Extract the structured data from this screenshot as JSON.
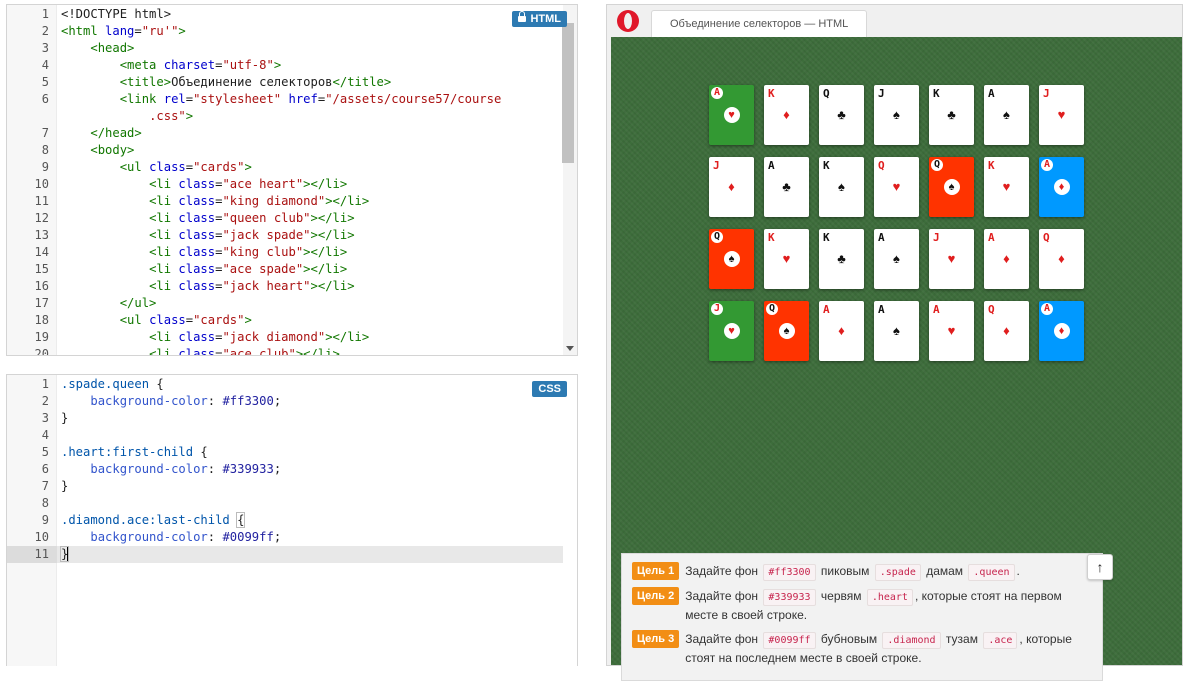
{
  "html_editor": {
    "badge": "HTML",
    "lines": [
      {
        "n": "1",
        "tokens": [
          [
            "t-txt",
            "<!DOCTYPE html>"
          ]
        ]
      },
      {
        "n": "2",
        "tokens": [
          [
            "t-tag",
            "<html "
          ],
          [
            "t-attr",
            "lang"
          ],
          [
            "t-txt",
            "="
          ],
          [
            "t-str",
            "\"ru'\""
          ],
          [
            "t-tag",
            ">"
          ]
        ]
      },
      {
        "n": "3",
        "tokens": [
          [
            "t-txt",
            "    "
          ],
          [
            "t-tag",
            "<head>"
          ]
        ]
      },
      {
        "n": "4",
        "tokens": [
          [
            "t-txt",
            "        "
          ],
          [
            "t-tag",
            "<meta "
          ],
          [
            "t-attr",
            "charset"
          ],
          [
            "t-txt",
            "="
          ],
          [
            "t-str",
            "\"utf-8\""
          ],
          [
            "t-tag",
            ">"
          ]
        ]
      },
      {
        "n": "5",
        "tokens": [
          [
            "t-txt",
            "        "
          ],
          [
            "t-tag",
            "<title>"
          ],
          [
            "t-txt",
            "Объединение селекторов"
          ],
          [
            "t-tag",
            "</title>"
          ]
        ]
      },
      {
        "n": "6",
        "tokens": [
          [
            "t-txt",
            "        "
          ],
          [
            "t-tag",
            "<link "
          ],
          [
            "t-attr",
            "rel"
          ],
          [
            "t-txt",
            "="
          ],
          [
            "t-str",
            "\"stylesheet\""
          ],
          [
            "t-txt",
            " "
          ],
          [
            "t-attr",
            "href"
          ],
          [
            "t-txt",
            "="
          ],
          [
            "t-str",
            "\"/assets/course57/course"
          ]
        ]
      },
      {
        "n": "",
        "tokens": [
          [
            "t-txt",
            "            "
          ],
          [
            "t-str",
            ".css\""
          ],
          [
            "t-tag",
            ">"
          ]
        ]
      },
      {
        "n": "7",
        "tokens": [
          [
            "t-txt",
            "    "
          ],
          [
            "t-tag",
            "</head>"
          ]
        ]
      },
      {
        "n": "8",
        "tokens": [
          [
            "t-txt",
            "    "
          ],
          [
            "t-tag",
            "<body>"
          ]
        ]
      },
      {
        "n": "9",
        "tokens": [
          [
            "t-txt",
            "        "
          ],
          [
            "t-tag",
            "<ul "
          ],
          [
            "t-attr",
            "class"
          ],
          [
            "t-txt",
            "="
          ],
          [
            "t-str",
            "\"cards\""
          ],
          [
            "t-tag",
            ">"
          ]
        ]
      },
      {
        "n": "10",
        "tokens": [
          [
            "t-txt",
            "            "
          ],
          [
            "t-tag",
            "<li "
          ],
          [
            "t-attr",
            "class"
          ],
          [
            "t-txt",
            "="
          ],
          [
            "t-str",
            "\"ace heart\""
          ],
          [
            "t-tag",
            "></li>"
          ]
        ]
      },
      {
        "n": "11",
        "tokens": [
          [
            "t-txt",
            "            "
          ],
          [
            "t-tag",
            "<li "
          ],
          [
            "t-attr",
            "class"
          ],
          [
            "t-txt",
            "="
          ],
          [
            "t-str",
            "\"king diamond\""
          ],
          [
            "t-tag",
            "></li>"
          ]
        ]
      },
      {
        "n": "12",
        "tokens": [
          [
            "t-txt",
            "            "
          ],
          [
            "t-tag",
            "<li "
          ],
          [
            "t-attr",
            "class"
          ],
          [
            "t-txt",
            "="
          ],
          [
            "t-str",
            "\"queen club\""
          ],
          [
            "t-tag",
            "></li>"
          ]
        ]
      },
      {
        "n": "13",
        "tokens": [
          [
            "t-txt",
            "            "
          ],
          [
            "t-tag",
            "<li "
          ],
          [
            "t-attr",
            "class"
          ],
          [
            "t-txt",
            "="
          ],
          [
            "t-str",
            "\"jack spade\""
          ],
          [
            "t-tag",
            "></li>"
          ]
        ]
      },
      {
        "n": "14",
        "tokens": [
          [
            "t-txt",
            "            "
          ],
          [
            "t-tag",
            "<li "
          ],
          [
            "t-attr",
            "class"
          ],
          [
            "t-txt",
            "="
          ],
          [
            "t-str",
            "\"king club\""
          ],
          [
            "t-tag",
            "></li>"
          ]
        ]
      },
      {
        "n": "15",
        "tokens": [
          [
            "t-txt",
            "            "
          ],
          [
            "t-tag",
            "<li "
          ],
          [
            "t-attr",
            "class"
          ],
          [
            "t-txt",
            "="
          ],
          [
            "t-str",
            "\"ace spade\""
          ],
          [
            "t-tag",
            "></li>"
          ]
        ]
      },
      {
        "n": "16",
        "tokens": [
          [
            "t-txt",
            "            "
          ],
          [
            "t-tag",
            "<li "
          ],
          [
            "t-attr",
            "class"
          ],
          [
            "t-txt",
            "="
          ],
          [
            "t-str",
            "\"jack heart\""
          ],
          [
            "t-tag",
            "></li>"
          ]
        ]
      },
      {
        "n": "17",
        "tokens": [
          [
            "t-txt",
            "        "
          ],
          [
            "t-tag",
            "</ul>"
          ]
        ]
      },
      {
        "n": "18",
        "tokens": [
          [
            "t-txt",
            "        "
          ],
          [
            "t-tag",
            "<ul "
          ],
          [
            "t-attr",
            "class"
          ],
          [
            "t-txt",
            "="
          ],
          [
            "t-str",
            "\"cards\""
          ],
          [
            "t-tag",
            ">"
          ]
        ]
      },
      {
        "n": "19",
        "tokens": [
          [
            "t-txt",
            "            "
          ],
          [
            "t-tag",
            "<li "
          ],
          [
            "t-attr",
            "class"
          ],
          [
            "t-txt",
            "="
          ],
          [
            "t-str",
            "\"jack diamond\""
          ],
          [
            "t-tag",
            "></li>"
          ]
        ]
      },
      {
        "n": "20",
        "tokens": [
          [
            "t-txt",
            "            "
          ],
          [
            "t-tag",
            "<li "
          ],
          [
            "t-attr",
            "class"
          ],
          [
            "t-txt",
            "="
          ],
          [
            "t-str",
            "\"ace club\""
          ],
          [
            "t-tag",
            "></li>"
          ]
        ]
      }
    ]
  },
  "css_editor": {
    "badge": "CSS",
    "lines": [
      {
        "n": "1",
        "tokens": [
          [
            "t-sel",
            ".spade.queen"
          ],
          [
            "t-txt",
            " {"
          ]
        ]
      },
      {
        "n": "2",
        "tokens": [
          [
            "t-txt",
            "    "
          ],
          [
            "t-prop",
            "background-color"
          ],
          [
            "t-txt",
            ": "
          ],
          [
            "t-val",
            "#ff3300"
          ],
          [
            "t-txt",
            ";"
          ]
        ]
      },
      {
        "n": "3",
        "tokens": [
          [
            "t-txt",
            "}"
          ]
        ]
      },
      {
        "n": "4",
        "tokens": []
      },
      {
        "n": "5",
        "tokens": [
          [
            "t-sel",
            ".heart:first-child"
          ],
          [
            "t-txt",
            " {"
          ]
        ]
      },
      {
        "n": "6",
        "tokens": [
          [
            "t-txt",
            "    "
          ],
          [
            "t-prop",
            "background-color"
          ],
          [
            "t-txt",
            ": "
          ],
          [
            "t-val",
            "#339933"
          ],
          [
            "t-txt",
            ";"
          ]
        ]
      },
      {
        "n": "7",
        "tokens": [
          [
            "t-txt",
            "}"
          ]
        ]
      },
      {
        "n": "8",
        "tokens": []
      },
      {
        "n": "9",
        "tokens": [
          [
            "t-sel",
            ".diamond.ace:last-child"
          ],
          [
            "t-txt",
            " "
          ],
          [
            "bracket",
            "{"
          ]
        ]
      },
      {
        "n": "10",
        "tokens": [
          [
            "t-txt",
            "    "
          ],
          [
            "t-prop",
            "background-color"
          ],
          [
            "t-txt",
            ": "
          ],
          [
            "t-val",
            "#0099ff"
          ],
          [
            "t-txt",
            ";"
          ]
        ]
      },
      {
        "n": "11",
        "tokens": [
          [
            "bracket",
            "}"
          ]
        ],
        "active": true
      }
    ]
  },
  "browser": {
    "tab_title": "Объединение селекторов — HTML"
  },
  "cards": [
    [
      {
        "rank": "A",
        "suit": "heart",
        "bg": "#339933"
      },
      {
        "rank": "K",
        "suit": "diamond"
      },
      {
        "rank": "Q",
        "suit": "club"
      },
      {
        "rank": "J",
        "suit": "spade"
      },
      {
        "rank": "K",
        "suit": "club"
      },
      {
        "rank": "A",
        "suit": "spade"
      },
      {
        "rank": "J",
        "suit": "heart"
      }
    ],
    [
      {
        "rank": "J",
        "suit": "diamond"
      },
      {
        "rank": "A",
        "suit": "club"
      },
      {
        "rank": "K",
        "suit": "spade"
      },
      {
        "rank": "Q",
        "suit": "heart"
      },
      {
        "rank": "Q",
        "suit": "spade",
        "bg": "#ff3300"
      },
      {
        "rank": "K",
        "suit": "heart"
      },
      {
        "rank": "A",
        "suit": "diamond",
        "bg": "#0099ff"
      }
    ],
    [
      {
        "rank": "Q",
        "suit": "spade",
        "bg": "#ff3300"
      },
      {
        "rank": "K",
        "suit": "heart"
      },
      {
        "rank": "K",
        "suit": "club"
      },
      {
        "rank": "A",
        "suit": "spade"
      },
      {
        "rank": "J",
        "suit": "heart"
      },
      {
        "rank": "A",
        "suit": "diamond"
      },
      {
        "rank": "Q",
        "suit": "diamond"
      }
    ],
    [
      {
        "rank": "J",
        "suit": "heart",
        "bg": "#339933"
      },
      {
        "rank": "Q",
        "suit": "spade",
        "bg": "#ff3300"
      },
      {
        "rank": "A",
        "suit": "diamond"
      },
      {
        "rank": "A",
        "suit": "spade"
      },
      {
        "rank": "A",
        "suit": "heart"
      },
      {
        "rank": "Q",
        "suit": "diamond"
      },
      {
        "rank": "A",
        "suit": "diamond",
        "bg": "#0099ff"
      }
    ]
  ],
  "goals": [
    {
      "label": "Цель 1",
      "parts": [
        [
          "text",
          "Задайте фон "
        ],
        [
          "code",
          "#ff3300"
        ],
        [
          "text",
          " пиковым "
        ],
        [
          "code",
          ".spade"
        ],
        [
          "text",
          " дамам "
        ],
        [
          "code",
          ".queen"
        ],
        [
          "text",
          "."
        ]
      ]
    },
    {
      "label": "Цель 2",
      "parts": [
        [
          "text",
          "Задайте фон "
        ],
        [
          "code",
          "#339933"
        ],
        [
          "text",
          " червям "
        ],
        [
          "code",
          ".heart"
        ],
        [
          "text",
          ", которые стоят на первом месте в своей строке."
        ]
      ]
    },
    {
      "label": "Цель 3",
      "parts": [
        [
          "text",
          "Задайте фон "
        ],
        [
          "code",
          "#0099ff"
        ],
        [
          "text",
          " бубновым "
        ],
        [
          "code",
          ".diamond"
        ],
        [
          "text",
          " тузам "
        ],
        [
          "code",
          ".ace"
        ],
        [
          "text",
          ", которые стоят на последнем месте в своей строке."
        ]
      ]
    }
  ],
  "up_button_icon": "arrow-up-icon",
  "up_button_label": "↑",
  "colors": {
    "accent_badge": "#2d7ab2",
    "goal_tag": "#f28e15",
    "felt": "#3d6d3b"
  }
}
